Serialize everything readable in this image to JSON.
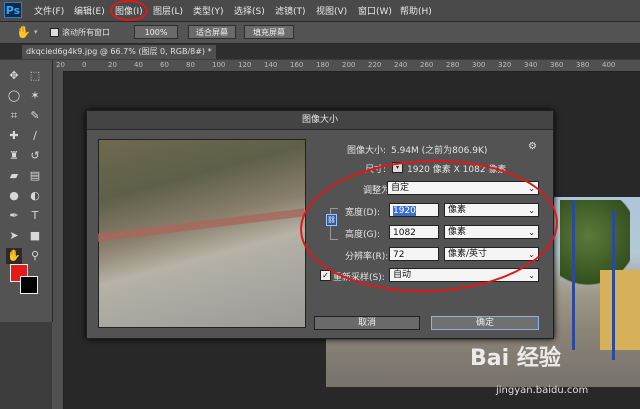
{
  "menubar": {
    "logo": "Ps",
    "items": [
      "文件(F)",
      "编辑(E)",
      "图像(I)",
      "图层(L)",
      "类型(Y)",
      "选择(S)",
      "滤镜(T)",
      "视图(V)",
      "窗口(W)",
      "帮助(H)"
    ]
  },
  "options": {
    "scroll_all_label": "滚动所有窗口",
    "zoom_100": "100%",
    "fit_screen": "适合屏幕",
    "fill_screen": "填充屏幕"
  },
  "document": {
    "tab_title": "dkqcied6g4k9.jpg @ 66.7% (图层 0, RGB/8#) *"
  },
  "ruler": {
    "ticks": [
      "20",
      "0",
      "20",
      "40",
      "60",
      "80",
      "100",
      "120",
      "140",
      "160",
      "180",
      "200",
      "220",
      "240",
      "260",
      "280",
      "300",
      "320",
      "340",
      "360",
      "380",
      "400"
    ]
  },
  "dialog": {
    "title": "图像大小",
    "image_size_label": "图像大小:",
    "image_size_value": "5.94M (之前为806.9K)",
    "dimensions_label": "尺寸:",
    "dimensions_value": "1920 像素  X  1082 像素",
    "resize_label": "调整为:",
    "resize_value": "自定",
    "width_label": "宽度(D):",
    "width_value": "1920",
    "width_unit": "像素",
    "height_label": "高度(G):",
    "height_value": "1082",
    "height_unit": "像素",
    "resolution_label": "分辨率(R):",
    "resolution_value": "72",
    "resolution_unit": "像素/英寸",
    "resample_label": "重新采样(S):",
    "resample_value": "自动",
    "cancel": "取消",
    "ok": "确定"
  },
  "watermark": {
    "brand": "Bai  经验",
    "url": "jingyan.baidu.com"
  },
  "colors": {
    "annotation_red": "#e01818",
    "foreground": "#e31b1b",
    "background": "#000000"
  },
  "icons": [
    "hand-tool-icon",
    "move-tool-icon",
    "marquee-tool-icon",
    "lasso-tool-icon",
    "magic-wand-icon",
    "crop-tool-icon",
    "eyedropper-icon",
    "healing-brush-icon",
    "brush-tool-icon",
    "clone-stamp-icon",
    "history-brush-icon",
    "eraser-icon",
    "gradient-icon",
    "blur-icon",
    "dodge-icon",
    "pen-tool-icon",
    "type-tool-icon",
    "path-selection-icon",
    "shape-tool-icon",
    "zoom-tool-icon",
    "gear-icon",
    "chain-link-icon"
  ]
}
